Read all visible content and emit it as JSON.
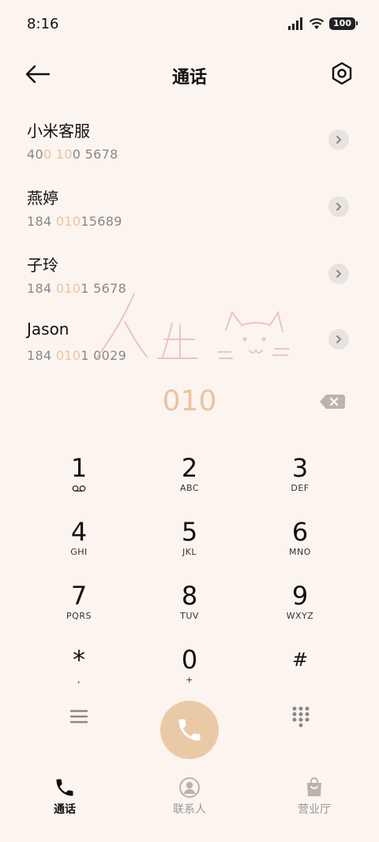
{
  "status_bar": {
    "time": "8:16",
    "battery": "100"
  },
  "header": {
    "title": "通话"
  },
  "contacts": [
    {
      "name": "小米客服",
      "number_parts": [
        "40",
        "0 10",
        "0 5678"
      ]
    },
    {
      "name": "燕婷",
      "number_parts": [
        "184 ",
        "010",
        "15689"
      ]
    },
    {
      "name": "子玲",
      "number_parts": [
        "184 ",
        "010",
        "1 5678"
      ]
    },
    {
      "name": "Jason",
      "number_parts": [
        "184 ",
        "010",
        "1 0029"
      ]
    }
  ],
  "dial": {
    "value": "010"
  },
  "keypad": [
    {
      "digit": "1",
      "letters": ""
    },
    {
      "digit": "2",
      "letters": "ABC"
    },
    {
      "digit": "3",
      "letters": "DEF"
    },
    {
      "digit": "4",
      "letters": "GHI"
    },
    {
      "digit": "5",
      "letters": "JKL"
    },
    {
      "digit": "6",
      "letters": "MNO"
    },
    {
      "digit": "7",
      "letters": "PQRS"
    },
    {
      "digit": "8",
      "letters": "TUV"
    },
    {
      "digit": "9",
      "letters": "WXYZ"
    },
    {
      "digit": "*",
      "letters": ","
    },
    {
      "digit": "0",
      "letters": "+"
    },
    {
      "digit": "#",
      "letters": ""
    }
  ],
  "bottom_nav": [
    {
      "label": "通话",
      "icon": "phone-icon",
      "active": true
    },
    {
      "label": "联系人",
      "icon": "person-icon",
      "active": false
    },
    {
      "label": "营业厅",
      "icon": "shopping-bag-icon",
      "active": false
    }
  ],
  "colors": {
    "background": "#FCF4EF",
    "accent": "#E8C4A0",
    "call_button": "#EACAA6"
  }
}
